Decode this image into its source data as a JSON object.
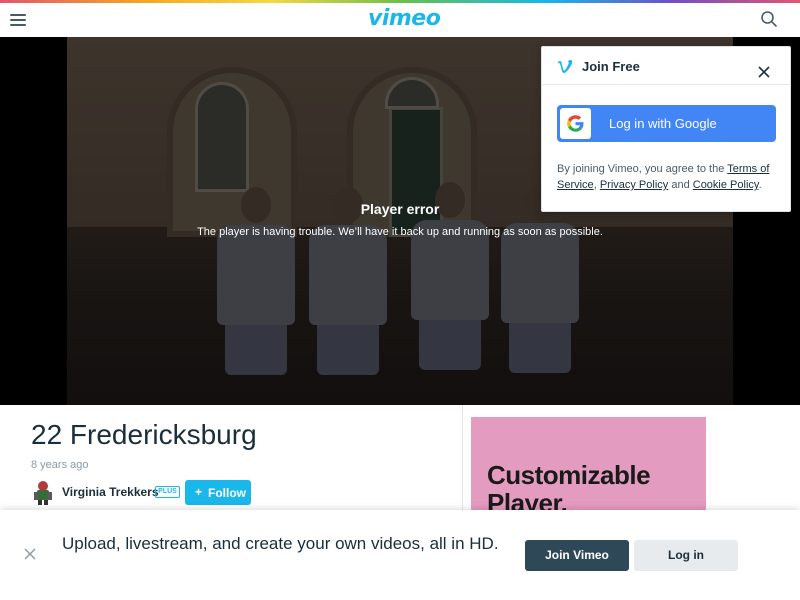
{
  "header": {
    "logo_text": "vimeo",
    "menu_icon": "hamburger-menu-icon",
    "search_icon": "search-icon",
    "brand_color": "#1ab7ea"
  },
  "player": {
    "error_title": "Player error",
    "error_message": "The player is having trouble. We’ll have it back up and running as soon as possible."
  },
  "join_popover": {
    "title": "Join Free",
    "close_icon": "close-icon",
    "google_button_label": "Log in with Google",
    "terms_prefix": "By joining Vimeo, you agree to the ",
    "terms_link": "Terms of Service",
    "comma": ", ",
    "privacy_link": "Privacy Policy",
    "and_text": " and ",
    "cookie_link": "Cookie Policy",
    "period": ".",
    "google_button_color": "#4285f4"
  },
  "video": {
    "title": "22 Fredericksburg",
    "age": "8 years ago",
    "uploader_name": "Virginia Trekkers",
    "uploader_badge": "PLUS",
    "follow_icon": "+",
    "follow_label": "Follow"
  },
  "ad": {
    "text": "Customizable Player.",
    "background": "#e49bc0"
  },
  "banner": {
    "text": "Upload, livestream, and create your own videos, all in HD.",
    "join_label": "Join Vimeo",
    "login_label": "Log in",
    "close_icon": "close-icon"
  }
}
